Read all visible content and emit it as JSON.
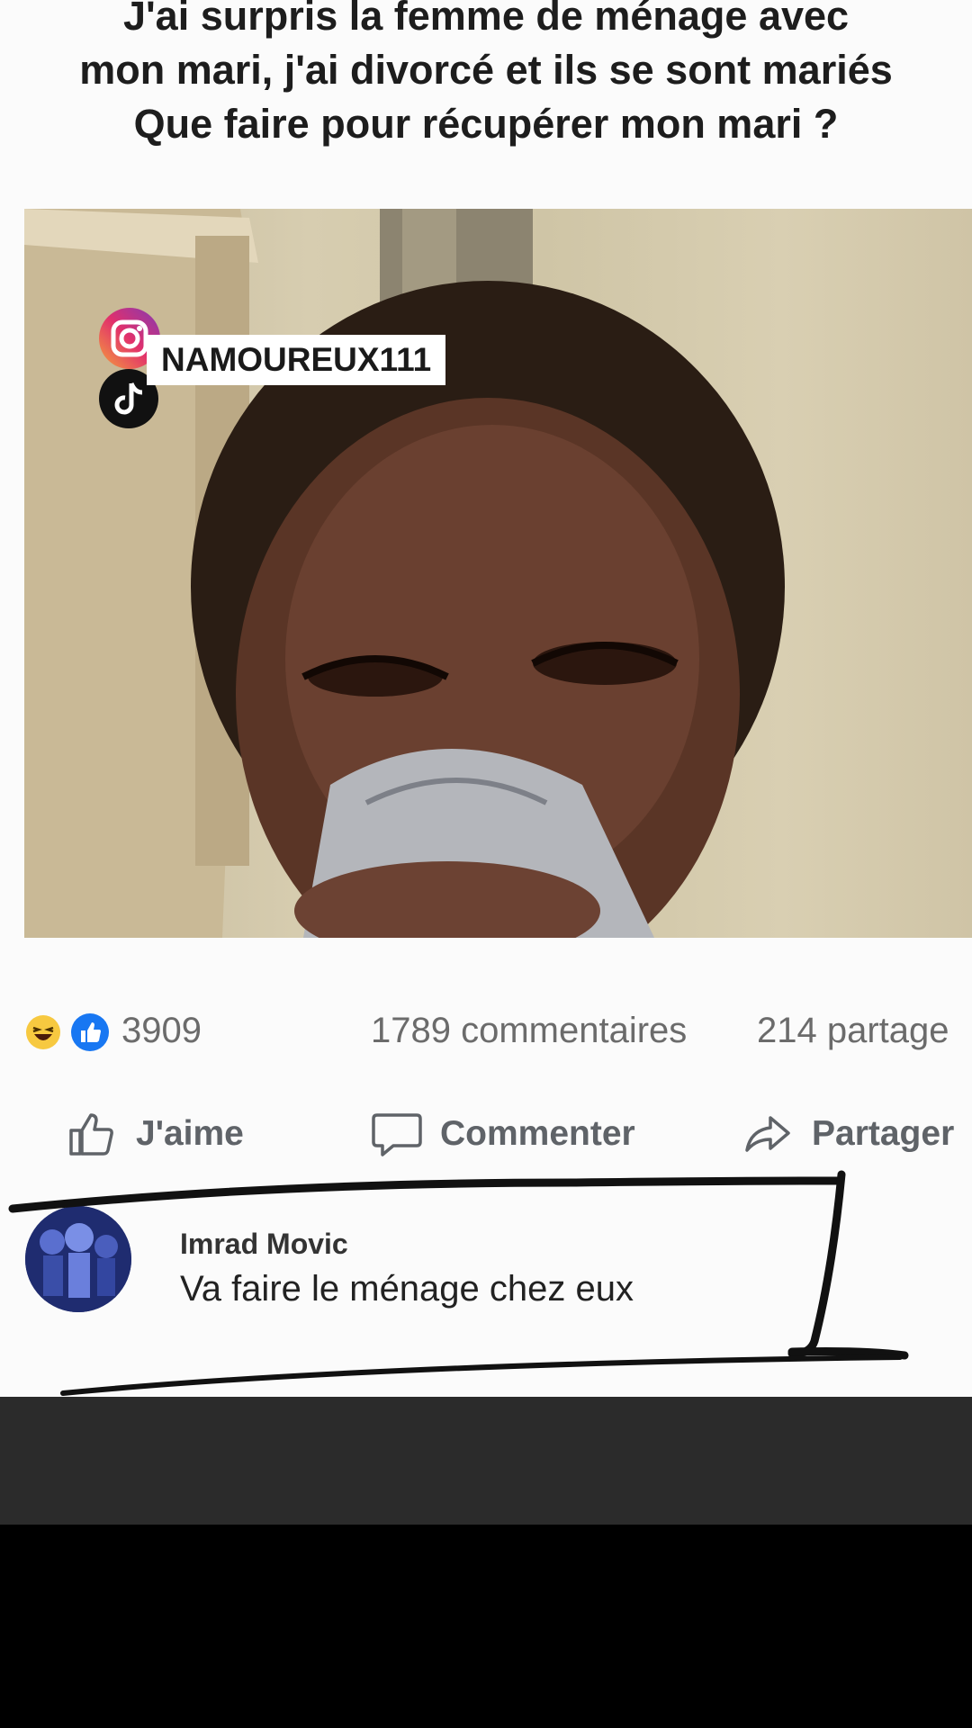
{
  "post": {
    "title_lines": [
      "J'ai surpris la femme de ménage avec",
      "mon mari, j'ai divorcé et ils se sont mariés",
      "Que faire pour récupérer mon mari ?"
    ],
    "photo_tag": "NAMOUREUX111",
    "reactions_count": "3909",
    "comments_count": "1789 commentaires",
    "shares_count": "214 partage"
  },
  "actions": {
    "like_label": "J'aime",
    "comment_label": "Commenter",
    "share_label": "Partager"
  },
  "comment": {
    "author": "Imrad Movic",
    "text": "Va faire le ménage chez eux"
  },
  "icons": {
    "reaction_1": "haha-emoji-icon",
    "reaction_2": "like-reaction-icon",
    "like": "thumbs-up-icon",
    "comment": "speech-bubble-icon",
    "share": "share-arrow-icon",
    "tag_1": "instagram-icon",
    "tag_2": "tiktok-icon"
  },
  "colors": {
    "like_blue": "#1877f2",
    "haha_yellow": "#f7c940",
    "marker": "#111111",
    "overlay_bar": "#2b2b2b"
  }
}
